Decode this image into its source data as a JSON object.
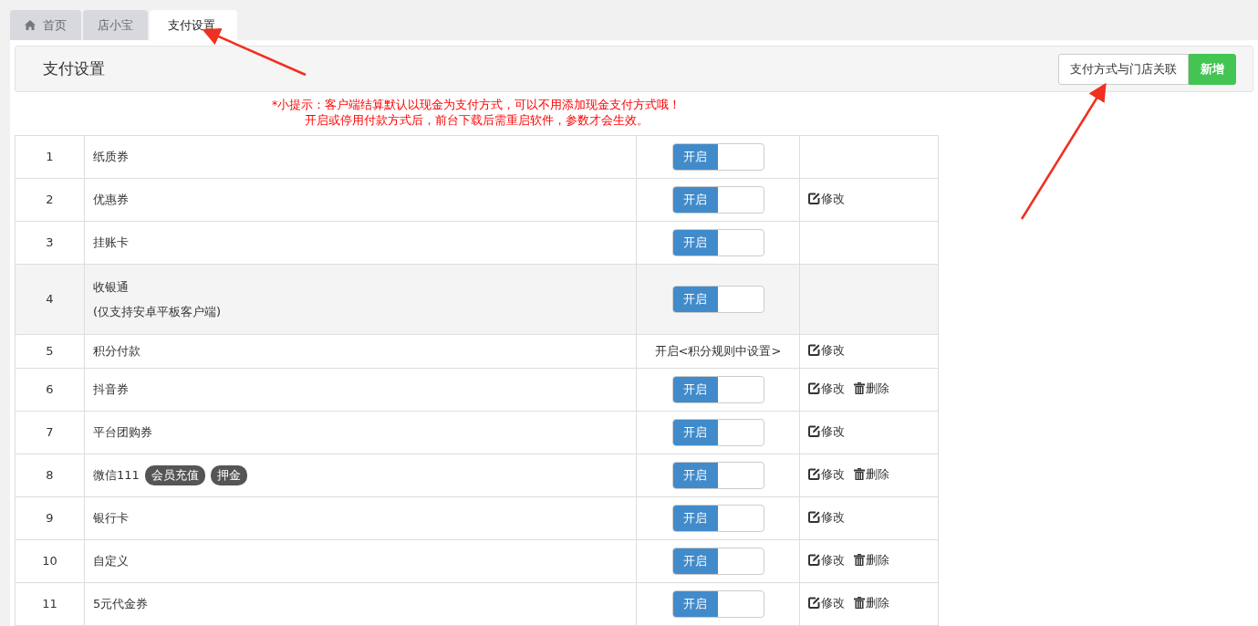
{
  "tabs": [
    {
      "label": "首页",
      "kind": "home",
      "selected": false
    },
    {
      "label": "店小宝",
      "selected": false
    },
    {
      "label": "支付设置",
      "selected": true
    }
  ],
  "header": {
    "title": "支付设置",
    "buttons": [
      {
        "label": "支付方式与门店关联",
        "kind": "default"
      },
      {
        "label": "新增",
        "kind": "success"
      }
    ]
  },
  "hints": [
    "*小提示：客户端结算默认以现金为支付方式，可以不用添加现金支付方式哦！",
    "开启或停用付款方式后，前台下载后需重启软件，参数才会生效。"
  ],
  "table": {
    "rows": [
      {
        "index": "1",
        "name": "纸质券",
        "status": {
          "kind": "toggle",
          "on": true,
          "label": "开启"
        },
        "actions": []
      },
      {
        "index": "2",
        "name": "优惠券",
        "status": {
          "kind": "toggle",
          "on": true,
          "label": "开启"
        },
        "actions": [
          {
            "kind": "edit",
            "label": "修改"
          }
        ]
      },
      {
        "index": "3",
        "name": "挂账卡",
        "status": {
          "kind": "toggle",
          "on": true,
          "label": "开启"
        },
        "actions": []
      },
      {
        "index": "4",
        "name": "收银通",
        "note": "(仅支持安卓平板客户端)",
        "highlighted": true,
        "status": {
          "kind": "toggle",
          "on": true,
          "label": "开启"
        },
        "actions": []
      },
      {
        "index": "5",
        "name": "积分付款",
        "status": {
          "kind": "text",
          "label": "开启<积分规则中设置>"
        },
        "actions": [
          {
            "kind": "edit",
            "label": "修改"
          }
        ]
      },
      {
        "index": "6",
        "name": "抖音券",
        "status": {
          "kind": "toggle",
          "on": true,
          "label": "开启"
        },
        "actions": [
          {
            "kind": "edit",
            "label": "修改"
          },
          {
            "kind": "delete",
            "label": "删除"
          }
        ]
      },
      {
        "index": "7",
        "name": "平台团购券",
        "status": {
          "kind": "toggle",
          "on": true,
          "label": "开启"
        },
        "actions": [
          {
            "kind": "edit",
            "label": "修改"
          }
        ]
      },
      {
        "index": "8",
        "name": "微信111",
        "tags": [
          "会员充值",
          "押金"
        ],
        "status": {
          "kind": "toggle",
          "on": true,
          "label": "开启"
        },
        "actions": [
          {
            "kind": "edit",
            "label": "修改"
          },
          {
            "kind": "delete",
            "label": "删除"
          }
        ]
      },
      {
        "index": "9",
        "name": "银行卡",
        "status": {
          "kind": "toggle",
          "on": true,
          "label": "开启"
        },
        "actions": [
          {
            "kind": "edit",
            "label": "修改"
          }
        ]
      },
      {
        "index": "10",
        "name": "自定义",
        "status": {
          "kind": "toggle",
          "on": true,
          "label": "开启"
        },
        "actions": [
          {
            "kind": "edit",
            "label": "修改"
          },
          {
            "kind": "delete",
            "label": "删除"
          }
        ]
      },
      {
        "index": "11",
        "name": "5元代金券",
        "status": {
          "kind": "toggle",
          "on": true,
          "label": "开启"
        },
        "actions": [
          {
            "kind": "edit",
            "label": "修改"
          },
          {
            "kind": "delete",
            "label": "删除"
          }
        ]
      }
    ]
  }
}
